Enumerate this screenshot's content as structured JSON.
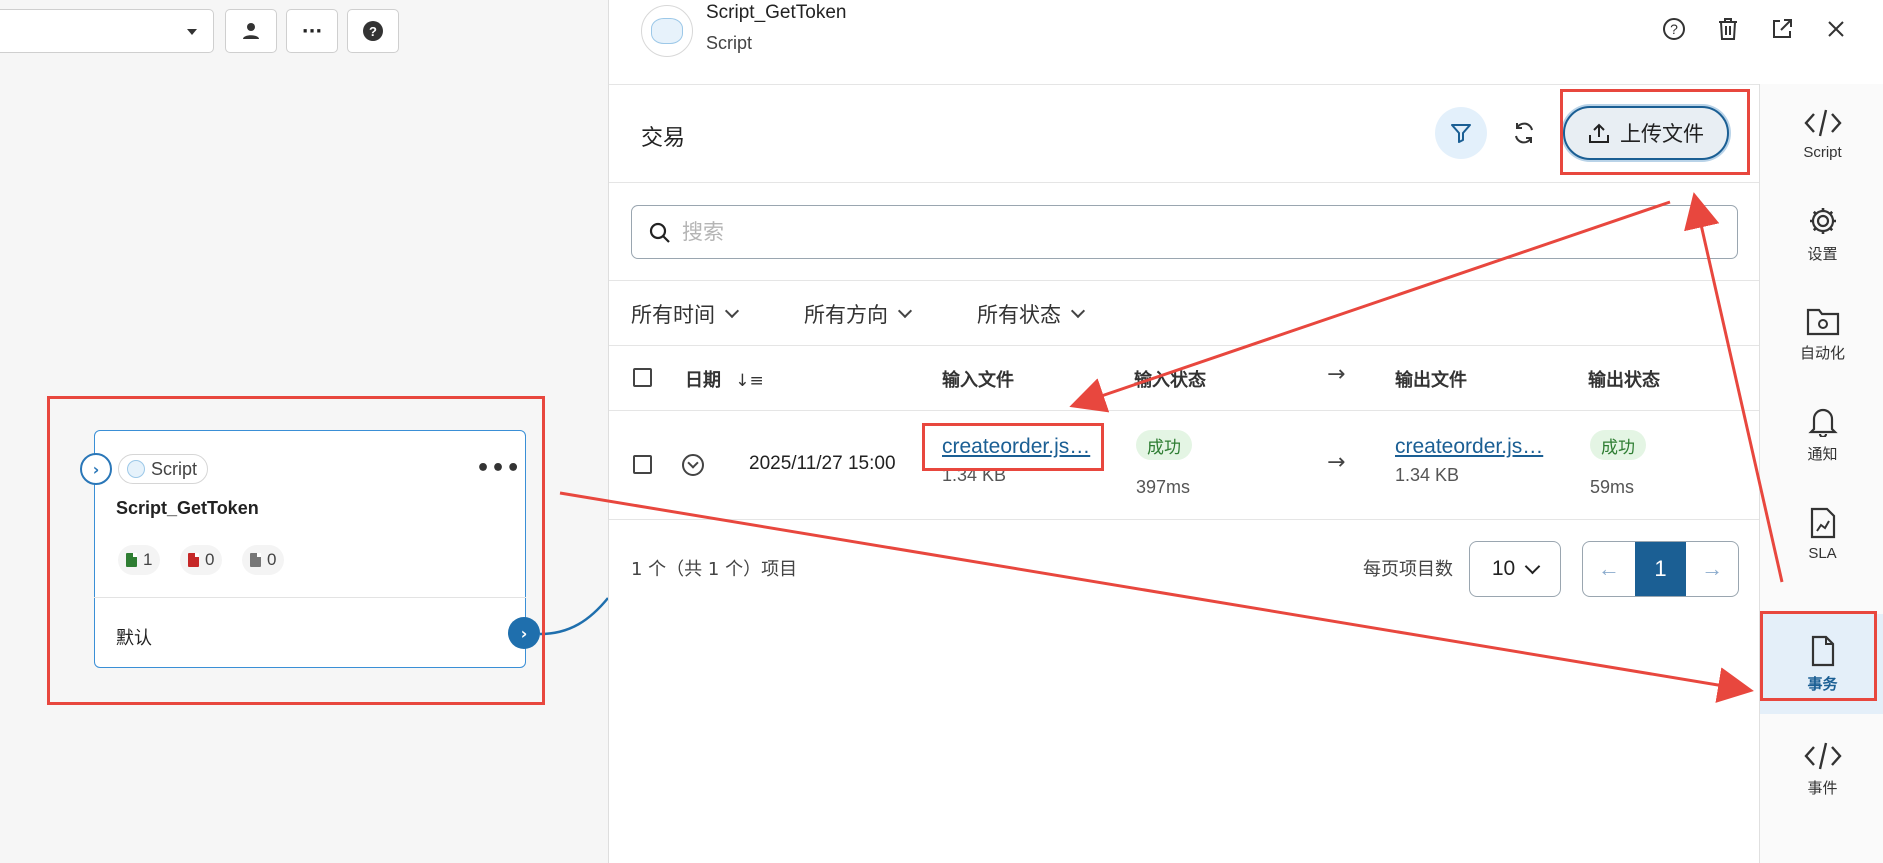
{
  "canvas": {
    "node": {
      "type_label": "Script",
      "title": "Script_GetToken",
      "stats": {
        "success": "1",
        "error": "0",
        "pending": "0"
      },
      "footer": "默认"
    }
  },
  "header": {
    "title": "Script_GetToken",
    "subtitle": "Script"
  },
  "section": {
    "title": "交易",
    "upload_label": "上传文件"
  },
  "search": {
    "placeholder": "搜索"
  },
  "filters": [
    "所有时间",
    "所有方向",
    "所有状态"
  ],
  "table": {
    "headers": {
      "date": "日期",
      "input_file": "输入文件",
      "input_status": "输入状态",
      "output_file": "输出文件",
      "output_status": "输出状态"
    },
    "rows": [
      {
        "date": "2025/11/27 15:00",
        "input_file": "createorder.js…",
        "input_size": "1.34 KB",
        "input_status": "成功",
        "input_time": "397ms",
        "output_file": "createorder.js…",
        "output_size": "1.34 KB",
        "output_status": "成功",
        "output_time": "59ms"
      }
    ]
  },
  "pagination": {
    "summary": "1 个（共 1 个）项目",
    "per_page_label": "每页项目数",
    "per_page_value": "10",
    "current_page": "1"
  },
  "rail": {
    "items": [
      {
        "label": "Script",
        "icon": "code-icon"
      },
      {
        "label": "设置",
        "icon": "gear-icon"
      },
      {
        "label": "自动化",
        "icon": "folder-gear-icon"
      },
      {
        "label": "通知",
        "icon": "bell-icon"
      },
      {
        "label": "SLA",
        "icon": "document-chart-icon"
      },
      {
        "label": "事务",
        "icon": "file-icon"
      },
      {
        "label": "事件",
        "icon": "code-icon"
      }
    ],
    "active": "事务"
  },
  "colors": {
    "accent": "#1b5f94",
    "annotation": "#e8473e",
    "success_bg": "#e4f5e4",
    "success_text": "#2e7d32"
  }
}
